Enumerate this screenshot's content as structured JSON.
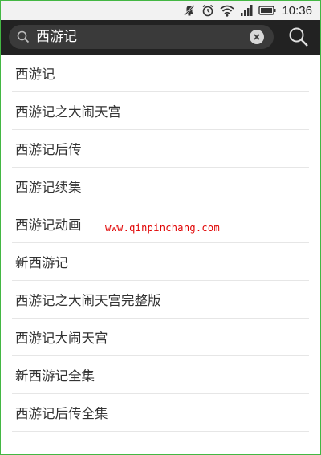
{
  "status_bar": {
    "time": "10:36",
    "icons": [
      "mute-icon",
      "alarm-icon",
      "wifi-icon",
      "signal-icon",
      "battery-icon"
    ]
  },
  "search": {
    "value": "西游记",
    "icons": [
      "search-icon",
      "clear-icon",
      "search-button-icon"
    ]
  },
  "suggestions": [
    "西游记",
    "西游记之大闹天宫",
    "西游记后传",
    "西游记续集",
    "西游记动画",
    "新西游记",
    "西游记之大闹天宫完整版",
    "西游记大闹天宫",
    "新西游记全集",
    "西游记后传全集"
  ],
  "watermark": "www.qinpinchang.com",
  "colors": {
    "search_bar_bg": "#222222",
    "frame_border": "#43b743",
    "watermark": "#e00000"
  }
}
